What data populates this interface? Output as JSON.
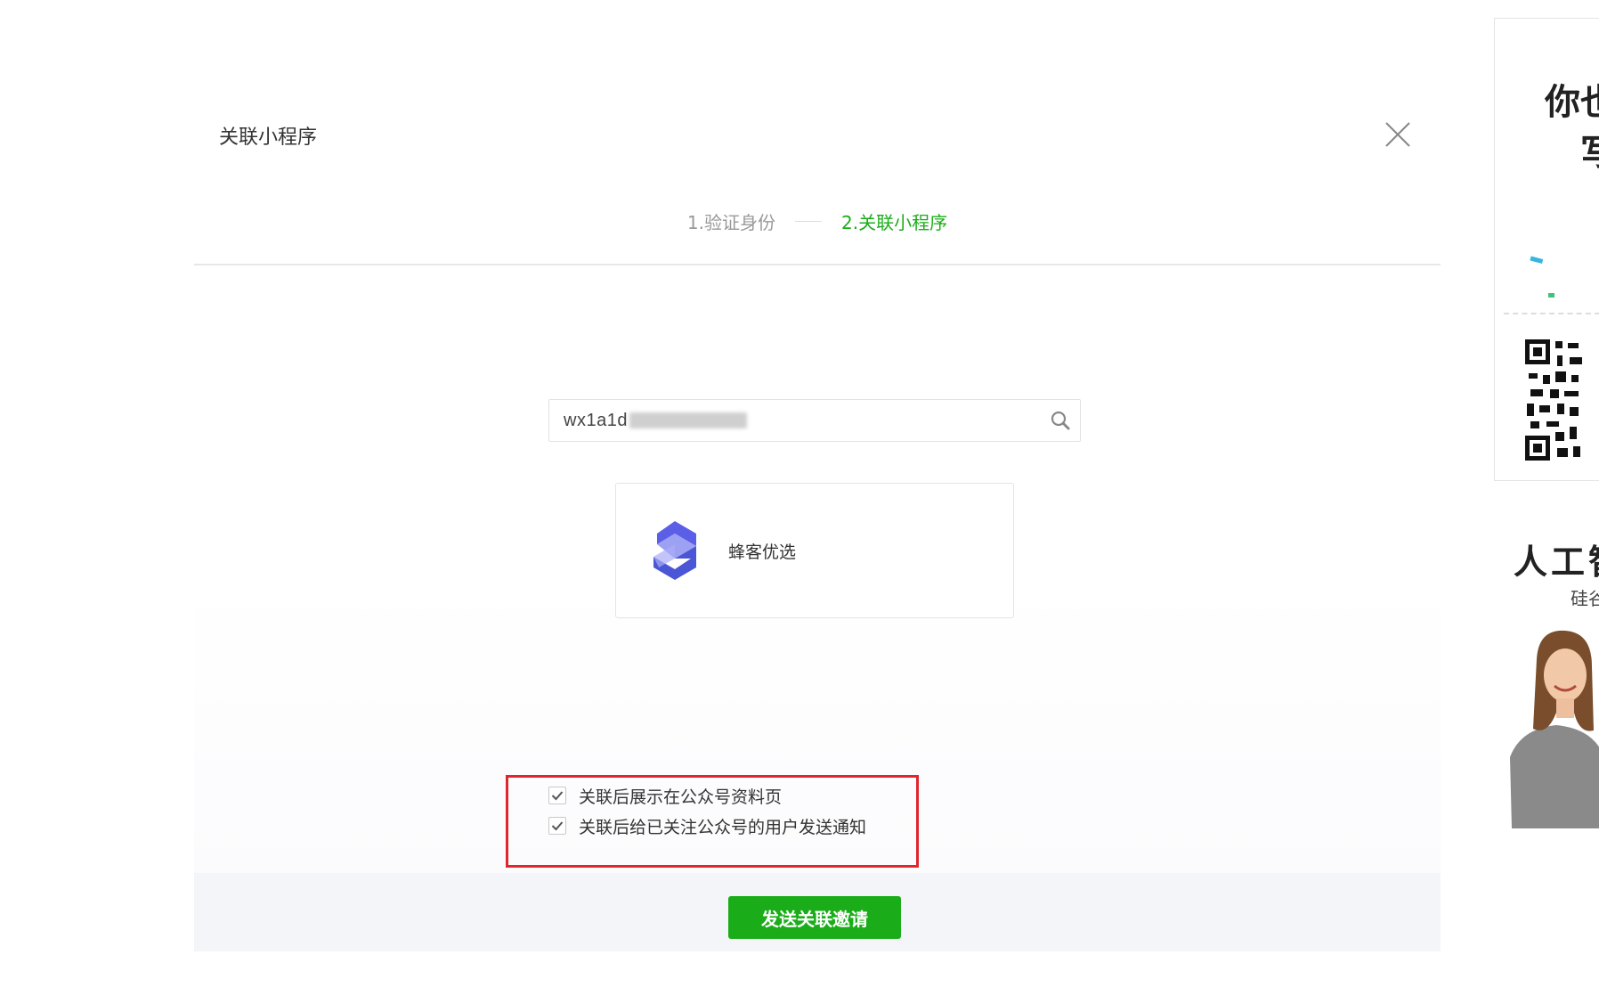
{
  "modal": {
    "title": "关联小程序",
    "steps": [
      {
        "label": "1.验证身份",
        "active": false
      },
      {
        "label": "2.关联小程序",
        "active": true
      }
    ],
    "search": {
      "value": "wx1a1d"
    },
    "result": {
      "name": "蜂客优选",
      "logo_icon": "bee-s-logo-icon"
    },
    "options": [
      {
        "label": "关联后展示在公众号资料页",
        "checked": true
      },
      {
        "label": "关联后给已关注公众号的用户发送通知",
        "checked": true
      }
    ],
    "submit_label": "发送关联邀请"
  },
  "ad": {
    "headline_line1": "你也",
    "headline_line2": "写",
    "title2": "人工智",
    "subtitle2": "硅谷"
  },
  "colors": {
    "accent_green": "#1aad19",
    "highlight_red": "#e0262d",
    "footer_bg": "#f4f5f9"
  }
}
